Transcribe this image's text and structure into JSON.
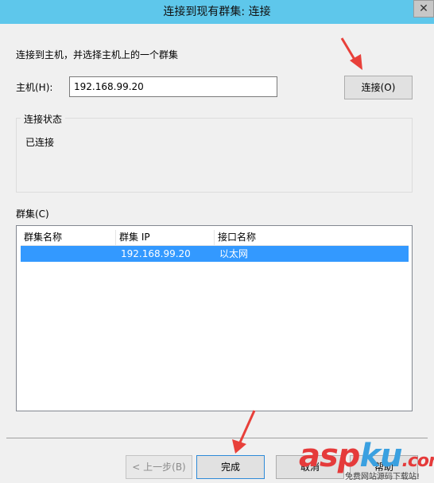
{
  "window": {
    "title": "连接到现有群集: 连接",
    "close_glyph": "✕"
  },
  "instruction": "连接到主机，并选择主机上的一个群集",
  "host": {
    "label": "主机(H):",
    "value": "192.168.99.20"
  },
  "connect_button": "连接(O)",
  "status_group": {
    "legend": "连接状态",
    "value": "已连接"
  },
  "clusters": {
    "label": "群集(C)",
    "columns": [
      "群集名称",
      "群集 IP",
      "接口名称"
    ],
    "rows": [
      {
        "name": "",
        "ip": "192.168.99.20",
        "interface": "以太网"
      }
    ]
  },
  "buttons": {
    "prev": "< 上一步(B)",
    "finish": "完成",
    "cancel": "取消",
    "help": "帮助"
  },
  "watermark": {
    "text_a": "asp",
    "text_b": "ku",
    "text_c": ".com",
    "sub": "免费网站源码下载站!"
  },
  "colors": {
    "titlebar": "#5ec7eb",
    "selection": "#3399ff",
    "arrow": "#e8403a"
  }
}
